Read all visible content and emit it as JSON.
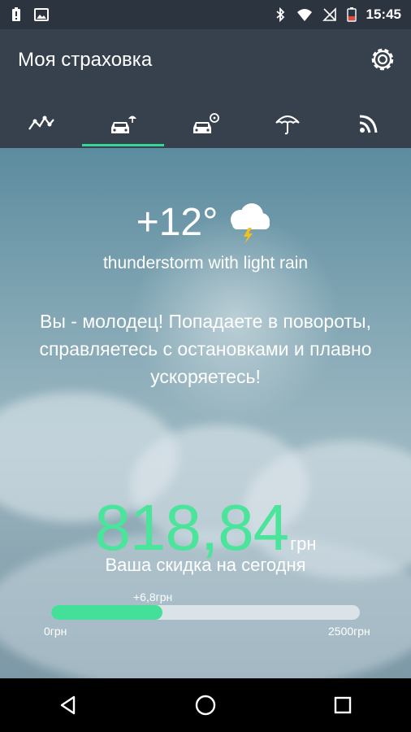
{
  "status_bar": {
    "time": "15:45",
    "icons": [
      "battery-alert-icon",
      "image-icon",
      "bluetooth-icon",
      "wifi-icon",
      "no-signal-icon",
      "battery-icon"
    ]
  },
  "app": {
    "title": "Моя страховка",
    "settings_icon": "gear-icon"
  },
  "tabs": [
    {
      "icon": "route-icon",
      "active": false
    },
    {
      "icon": "car-insurance-icon",
      "active": true
    },
    {
      "icon": "car-drive-icon",
      "active": false
    },
    {
      "icon": "umbrella-icon",
      "active": false
    },
    {
      "icon": "rss-feed-icon",
      "active": false
    }
  ],
  "weather": {
    "temperature": "+12°",
    "description": "thunderstorm with light rain",
    "icon": "thunderstorm-cloud-icon"
  },
  "message": "Вы - молодец! Попадаете в повороты, справляетесь с остановками и плавно ускоряетесь!",
  "discount": {
    "amount": "818,84",
    "currency": "грн",
    "label": "Ваша скидка на сегодня",
    "progress_delta": "+6,8грн",
    "min_label": "0грн",
    "max_label": "2500грн",
    "progress_fraction": 0.36
  },
  "colors": {
    "accent": "#44e09a",
    "appbar": "#37414e",
    "statusbar": "#2c3440"
  },
  "navbar": [
    "back-icon",
    "home-icon",
    "recents-icon"
  ]
}
